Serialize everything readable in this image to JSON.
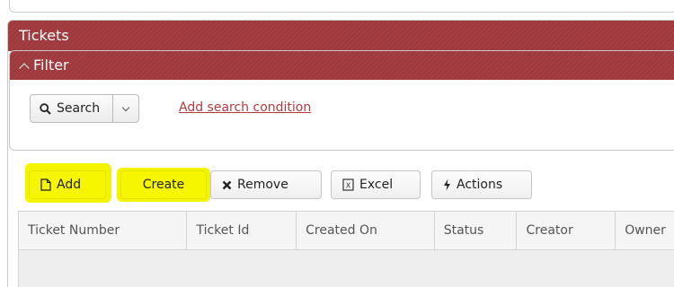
{
  "tickets": {
    "title": "Tickets"
  },
  "filter": {
    "title": "Filter",
    "search_label": "Search",
    "add_condition_label": "Add search condition"
  },
  "toolbar": {
    "add_label": "Add",
    "create_label": "Create",
    "remove_label": "Remove",
    "excel_label": "Excel",
    "actions_label": "Actions"
  },
  "grid": {
    "columns": [
      "Ticket Number",
      "Ticket Id",
      "Created On",
      "Status",
      "Creator",
      "Owner"
    ]
  },
  "colors": {
    "header_red": "#a43e42",
    "highlight_yellow": "#f6f600",
    "link_red": "#b43a3e"
  },
  "icons": {
    "filter_toggle": "chevron-up-icon",
    "search": "search-icon",
    "dropdown": "chevron-down-icon",
    "add": "new-document-icon",
    "remove": "close-x-icon",
    "excel": "excel-icon",
    "actions": "lightning-icon"
  }
}
